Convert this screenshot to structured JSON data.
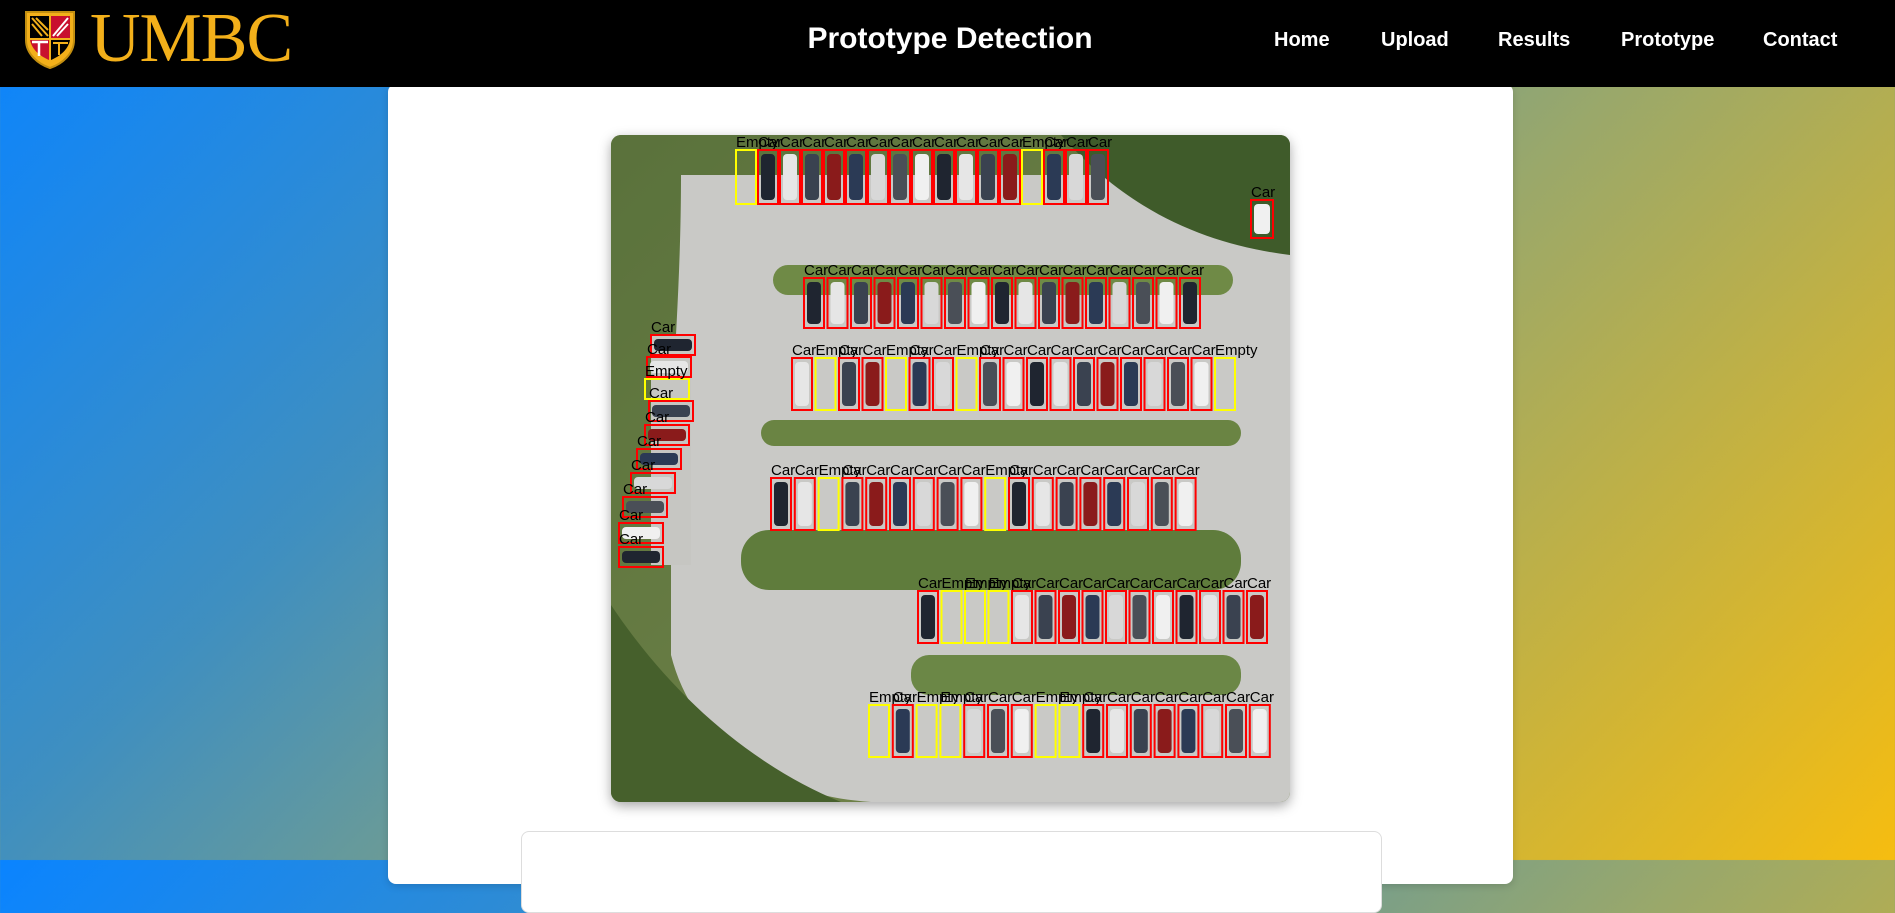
{
  "brand": {
    "logo_text": "UMBC"
  },
  "header": {
    "title": "Prototype Detection"
  },
  "nav": {
    "items": [
      "Home",
      "Upload",
      "Results",
      "Prototype",
      "Contact"
    ]
  },
  "detection": {
    "labels": {
      "car": "Car",
      "empty": "Empty"
    },
    "colors": {
      "car": "#ff0000",
      "empty": "#ffff00"
    }
  }
}
